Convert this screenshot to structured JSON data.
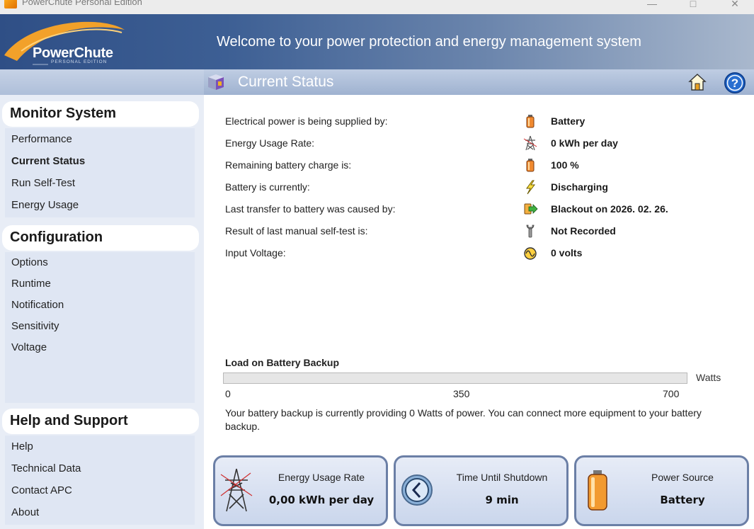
{
  "window": {
    "title": "PowerChute Personal Edition"
  },
  "header": {
    "logo_text": "PowerChute",
    "logo_sub": "PERSONAL EDITION",
    "welcome": "Welcome to your power protection and energy management system"
  },
  "toolbar": {
    "title": "Current Status"
  },
  "sidebar": {
    "monitor": {
      "title": "Monitor System",
      "items": [
        "Performance",
        "Current Status",
        "Run Self-Test",
        "Energy Usage"
      ]
    },
    "configuration": {
      "title": "Configuration",
      "items": [
        "Options",
        "Runtime",
        "Notification",
        "Sensitivity",
        "Voltage"
      ]
    },
    "help": {
      "title": "Help and Support",
      "items": [
        "Help",
        "Technical Data",
        "Contact APC",
        "About"
      ]
    }
  },
  "status": {
    "rows": [
      {
        "label": "Electrical power is being supplied by:",
        "value": "Battery",
        "icon": "battery-icon"
      },
      {
        "label": "Energy Usage Rate:",
        "value": "0 kWh per day",
        "icon": "power-tower-icon"
      },
      {
        "label": "Remaining battery charge is:",
        "value": "100 %",
        "icon": "battery-icon"
      },
      {
        "label": "Battery is currently:",
        "value": "Discharging",
        "icon": "lightning-icon"
      },
      {
        "label": "Last transfer to battery was caused by:",
        "value": "Blackout on 2026. 02. 26.",
        "icon": "transfer-icon"
      },
      {
        "label": "Result of last manual self-test is:",
        "value": "Not Recorded",
        "icon": "wrench-icon"
      },
      {
        "label": "Input Voltage:",
        "value": "0 volts",
        "icon": "voltage-icon"
      }
    ]
  },
  "load": {
    "title": "Load on Battery Backup",
    "unit": "Watts",
    "ticks": [
      "0",
      "350",
      "700"
    ],
    "current_watts": 0,
    "note": "Your battery backup is currently providing 0 Watts of power. You can connect more equipment to your battery backup."
  },
  "cards": [
    {
      "title": "Energy Usage Rate",
      "value": "0,00 kWh per day",
      "icon": "power-tower-icon"
    },
    {
      "title": "Time Until Shutdown",
      "value": "9 min",
      "icon": "clock-icon"
    },
    {
      "title": "Power Source",
      "value": "Battery",
      "icon": "battery-icon"
    }
  ]
}
